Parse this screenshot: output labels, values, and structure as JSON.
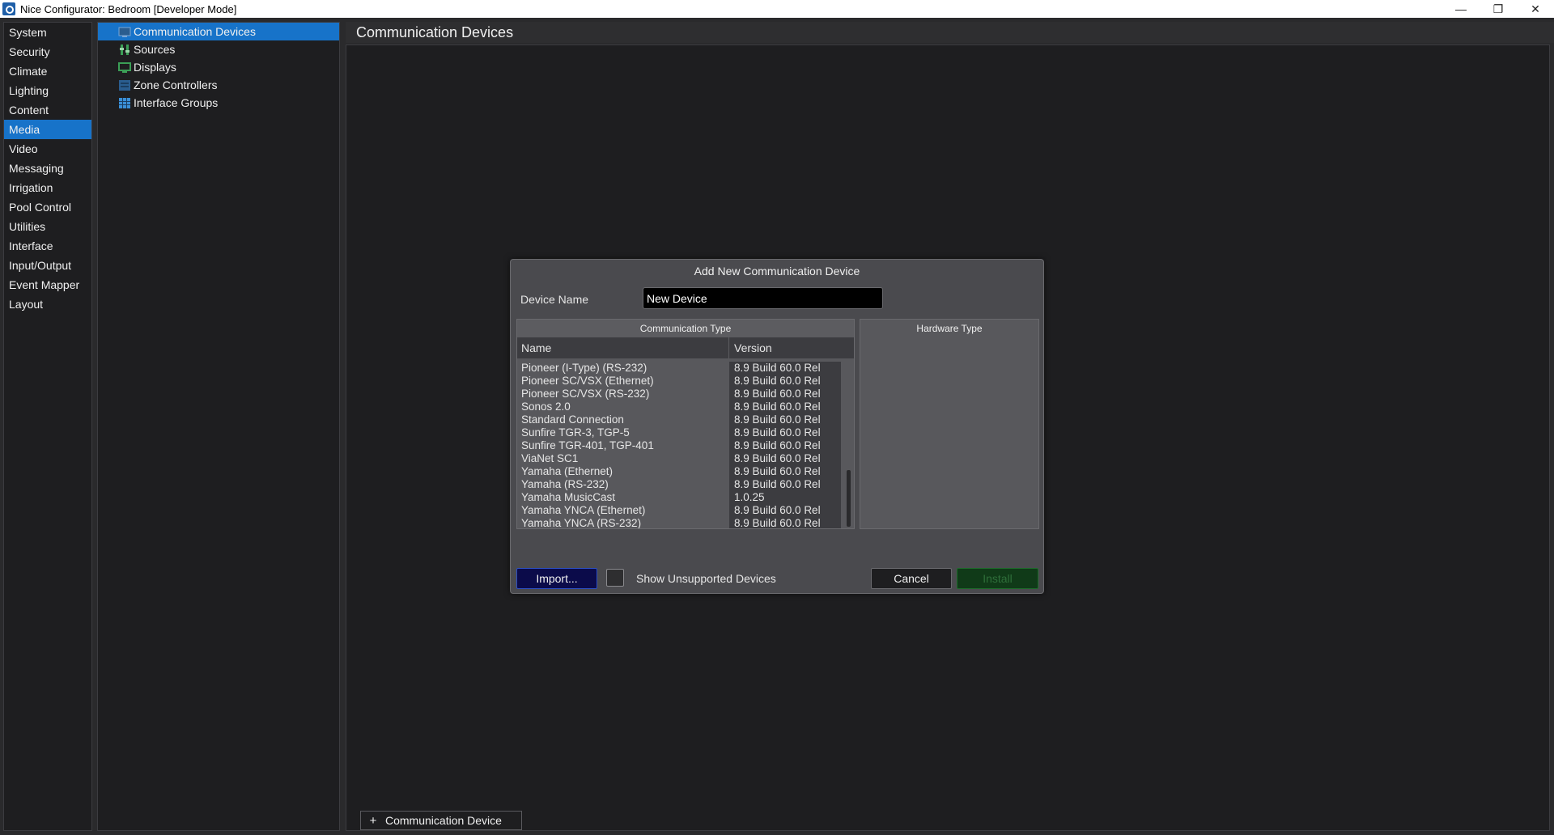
{
  "window": {
    "title": "Nice Configurator: Bedroom [Developer Mode]",
    "controls": {
      "minimize": "—",
      "restore": "❐",
      "close": "✕"
    }
  },
  "nav": {
    "items": [
      {
        "label": "System"
      },
      {
        "label": "Security"
      },
      {
        "label": "Climate"
      },
      {
        "label": "Lighting"
      },
      {
        "label": "Content"
      },
      {
        "label": "Media"
      },
      {
        "label": "Video"
      },
      {
        "label": "Messaging"
      },
      {
        "label": "Irrigation"
      },
      {
        "label": "Pool Control"
      },
      {
        "label": "Utilities"
      },
      {
        "label": "Interface"
      },
      {
        "label": "Input/Output"
      },
      {
        "label": "Event Mapper"
      },
      {
        "label": "Layout"
      }
    ],
    "active": "Media"
  },
  "tree": {
    "items": [
      {
        "label": "Communication Devices",
        "icon": "communication-device-icon"
      },
      {
        "label": "Sources",
        "icon": "sources-icon"
      },
      {
        "label": "Displays",
        "icon": "display-icon"
      },
      {
        "label": "Zone Controllers",
        "icon": "zone-controller-icon"
      },
      {
        "label": "Interface Groups",
        "icon": "interface-groups-icon"
      }
    ],
    "active": "Communication Devices"
  },
  "main": {
    "title": "Communication Devices",
    "add_button": {
      "plus": "+",
      "label": "Communication Device"
    }
  },
  "dialog": {
    "title": "Add New Communication Device",
    "device_name_label": "Device Name",
    "device_name_value": "New Device",
    "comm_type_title": "Communication Type",
    "columns": {
      "name": "Name",
      "version": "Version"
    },
    "rows": [
      {
        "name": "Pioneer (I-Type) (RS-232)",
        "version": "8.9 Build 60.0 Rel"
      },
      {
        "name": "Pioneer SC/VSX (Ethernet)",
        "version": "8.9 Build 60.0 Rel"
      },
      {
        "name": "Pioneer SC/VSX (RS-232)",
        "version": "8.9 Build 60.0 Rel"
      },
      {
        "name": "Sonos 2.0",
        "version": "8.9 Build 60.0 Rel"
      },
      {
        "name": "Standard Connection",
        "version": "8.9 Build 60.0 Rel"
      },
      {
        "name": "Sunfire TGR-3, TGP-5",
        "version": "8.9 Build 60.0 Rel"
      },
      {
        "name": "Sunfire TGR-401, TGP-401",
        "version": "8.9 Build 60.0 Rel"
      },
      {
        "name": "ViaNet SC1",
        "version": "8.9 Build 60.0 Rel"
      },
      {
        "name": "Yamaha (Ethernet)",
        "version": "8.9 Build 60.0 Rel"
      },
      {
        "name": "Yamaha (RS-232)",
        "version": "8.9 Build 60.0 Rel"
      },
      {
        "name": "Yamaha MusicCast",
        "version": "1.0.25"
      },
      {
        "name": "Yamaha YNCA (Ethernet)",
        "version": "8.9 Build 60.0 Rel"
      },
      {
        "name": "Yamaha YNCA (RS-232)",
        "version": "8.9 Build 60.0 Rel"
      }
    ],
    "hardware_type_title": "Hardware Type",
    "import_label": "Import...",
    "show_unsupported_label": "Show Unsupported Devices",
    "show_unsupported_checked": false,
    "cancel_label": "Cancel",
    "install_label": "Install",
    "install_enabled": false
  },
  "colors": {
    "accent": "#1773c9",
    "background": "#2a2a2c",
    "panel": "#1e1e20",
    "dialog": "#4a4a4e",
    "install_disabled": "#103a18",
    "import_button": "#0b0b4a"
  }
}
